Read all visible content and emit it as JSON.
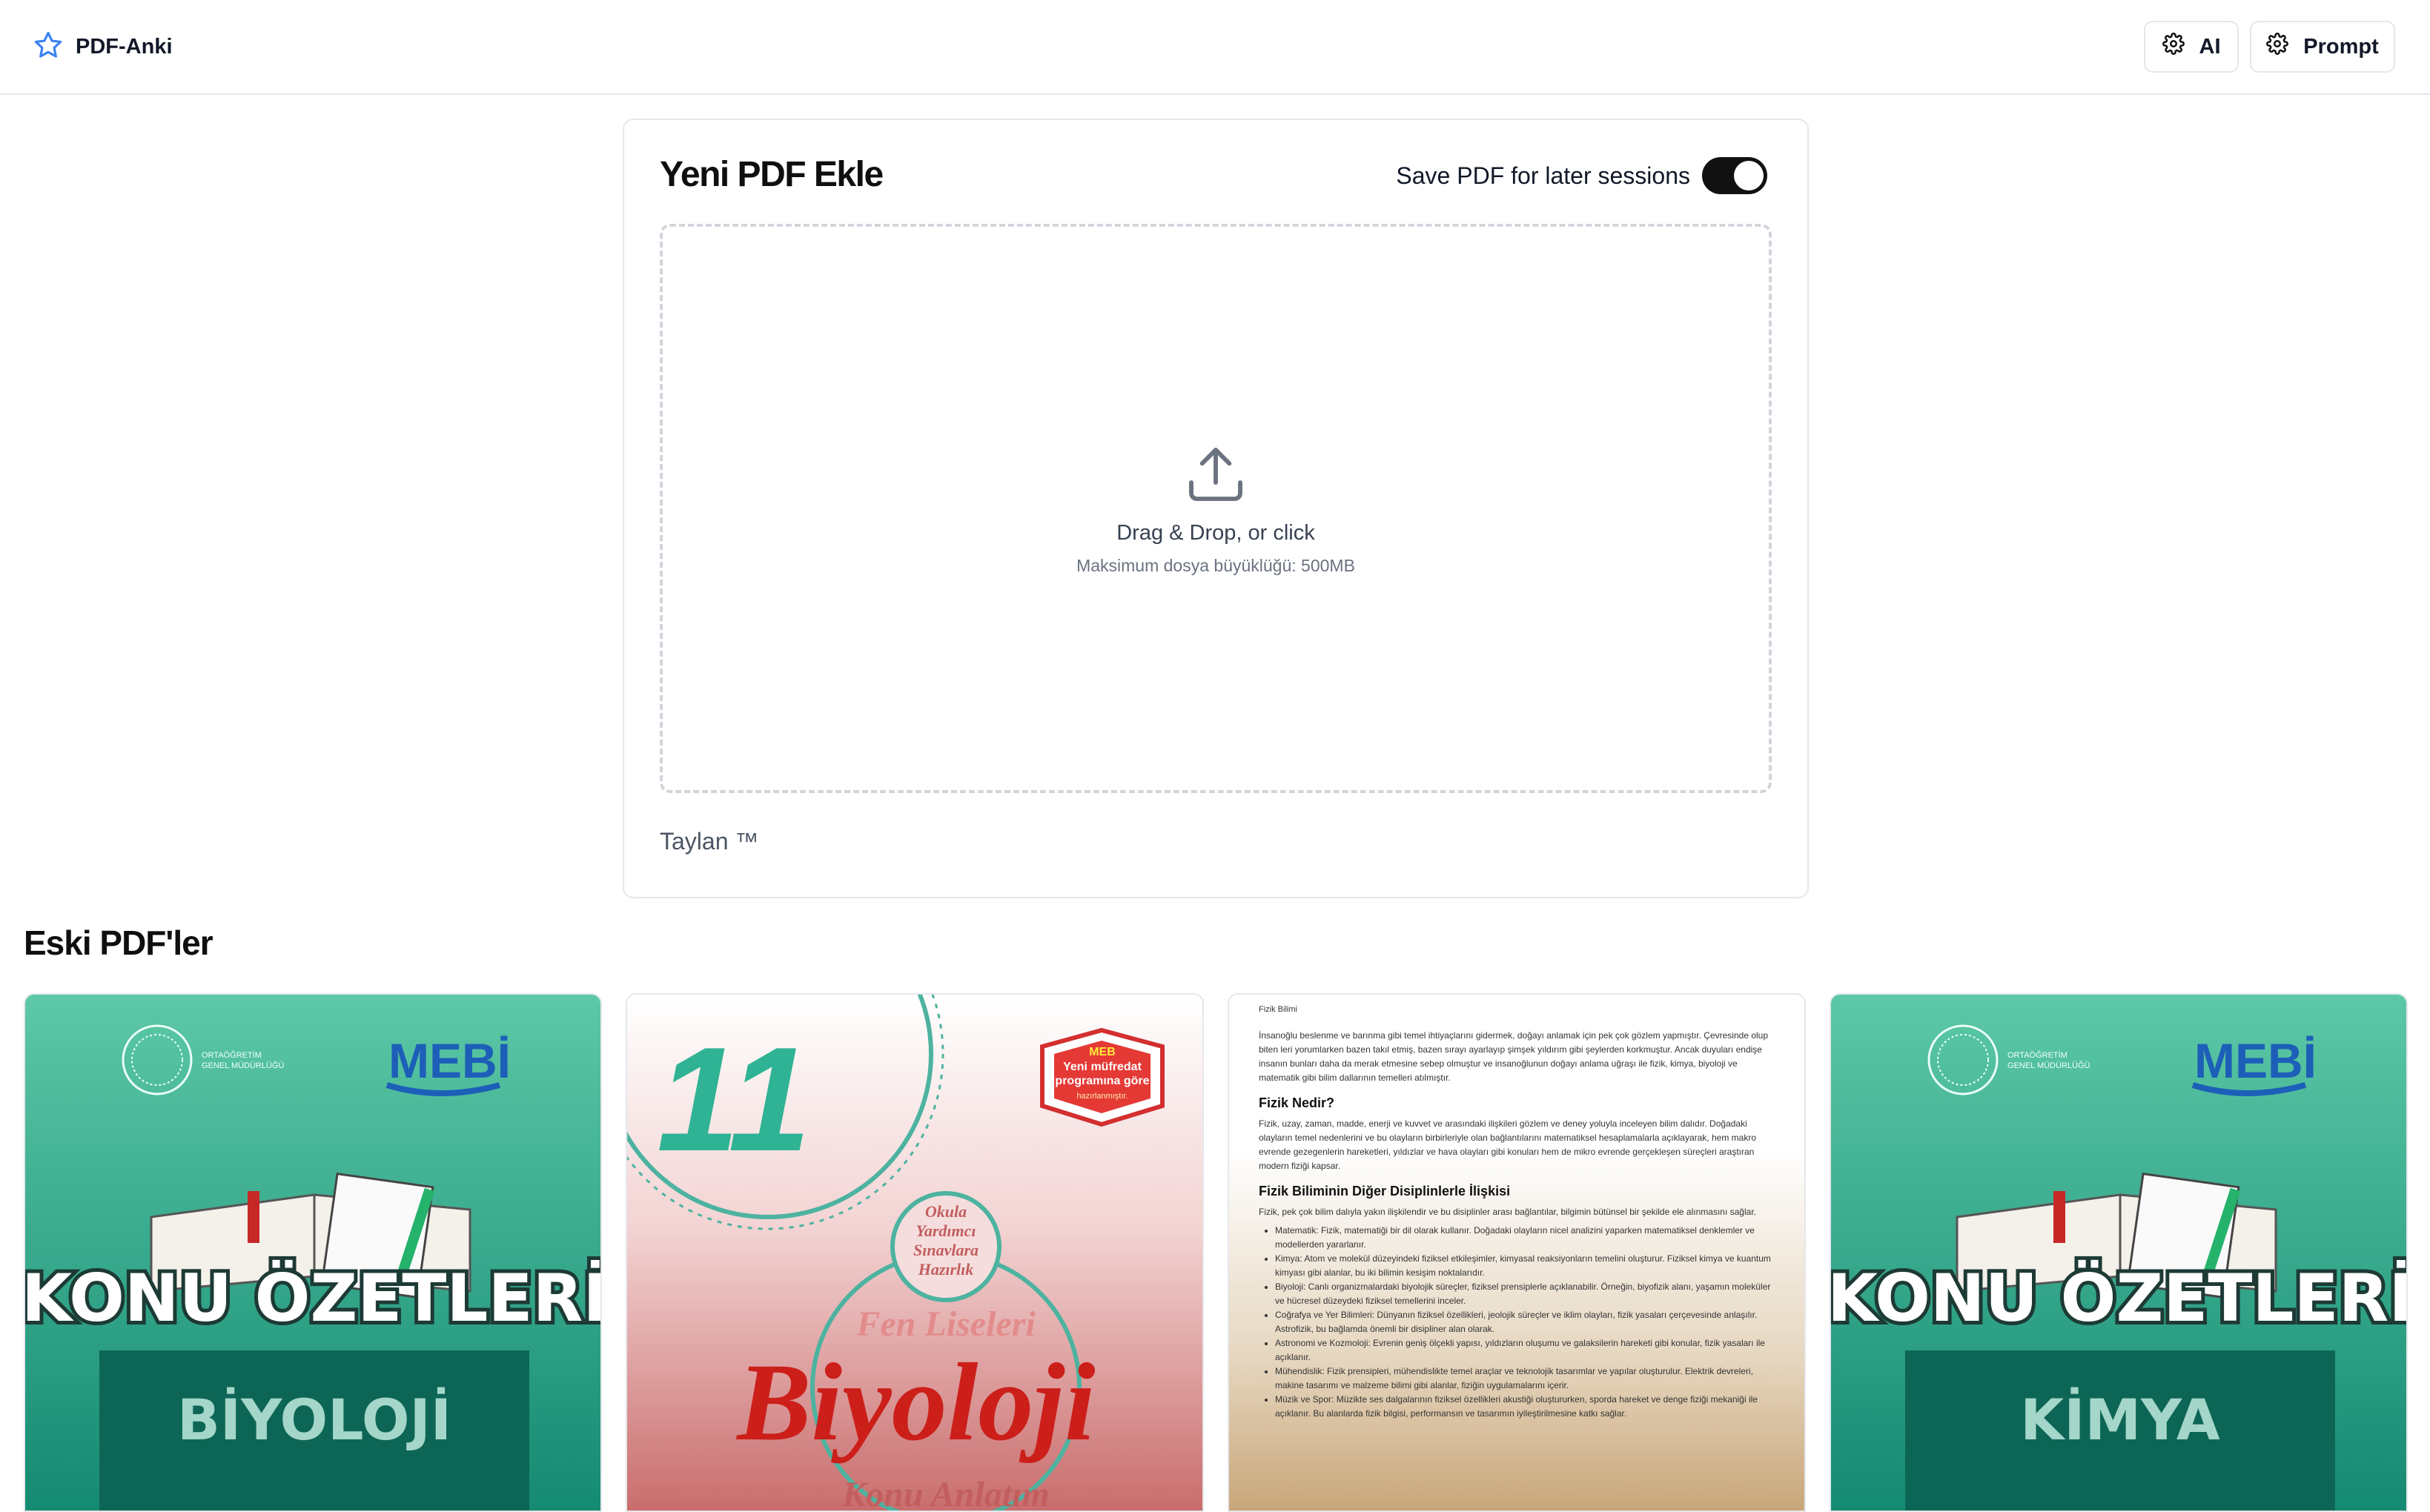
{
  "app": {
    "title": "PDF-Anki"
  },
  "header": {
    "ai_label": "AI",
    "prompt_label": "Prompt"
  },
  "upload": {
    "title": "Yeni PDF Ekle",
    "save_toggle_label": "Save PDF for later sessions",
    "save_toggle_on": true,
    "drop_title": "Drag & Drop, or click",
    "drop_subtitle": "Maksimum dosya büyüklüğü: 500MB",
    "footer": "Taylan ™"
  },
  "old_pdfs": {
    "title": "Eski PDF'ler",
    "items": [
      {
        "brand": "MEBİ",
        "org_line1": "ORTAÖĞRETİM",
        "org_line2": "GENEL MÜDÜRLÜĞÜ",
        "title": "KONU ÖZETLERİ",
        "subject": "BİYOLOJİ"
      },
      {
        "grade": "11",
        "badge_line1": "MEB",
        "badge_line2": "Yeni müfredat",
        "badge_line3": "programına göre",
        "badge_line4": "hazırlanmıştır.",
        "circle_line1": "Okula",
        "circle_line2": "Yardımcı",
        "circle_line3": "Sınavlara",
        "circle_line4": "Hazırlık",
        "series": "Fen Liseleri",
        "title": "Biyoloji",
        "subtitle": "Konu Anlatım"
      },
      {
        "running_head": "Fizik Bilimi",
        "intro": "İnsanoğlu beslenme ve barınma gibi temel ihtiyaçlarını gidermek, doğayı anlamak için pek çok gözlem yapmıştır. Çevresinde olup biten leri yorumlarken bazen takıl etmiş, bazen sırayı ayarlayıp şimşek yıldırım gibi şeylerden korkmuştur. Ancak duyuları endişe insanın bunları daha da merak etmesine sebep olmuştur ve insanoğlunun doğayı anlama uğraşı ile fizik, kimya, biyoloji ve matematik gibi bilim dallarının temelleri atılmıştır.",
        "h1": "Fizik Nedir?",
        "p1": "Fizik, uzay, zaman, madde, enerji ve kuvvet ve arasındaki ilişkileri gözlem ve deney yoluyla inceleyen bilim dalıdır. Doğadaki olayların temel nedenlerini ve bu olayların birbirleriyle olan bağlantılarını matematiksel hesaplamalarla açıklayarak, hem makro evrende gezegenlerin hareketleri, yıldızlar ve hava olayları gibi konuları hem de mikro evrende gerçekleşen süreçleri araştıran modern fiziği kapsar.",
        "h2": "Fizik Biliminin Diğer Disiplinlerle İlişkisi",
        "p2": "Fizik, pek çok bilim dalıyla yakın ilişkilendir ve bu disiplinler arası bağlantılar, bilgimin bütünsel bir şekilde ele alınmasını sağlar.",
        "bullets": [
          "Matematik: Fizik, matematiği bir dil olarak kullanır. Doğadaki olayların nicel analizini yaparken matematiksel denklemler ve modellerden yararlanır.",
          "Kimya: Atom ve molekül düzeyindeki fiziksel etkileşimler, kimyasal reaksiyonların temelini oluşturur. Fiziksel kimya ve kuantum kimyası gibi alanlar, bu iki bilimin kesişim noktalarıdır.",
          "Biyoloji: Canlı organizmalardaki biyolojik süreçler, fiziksel prensiplerle açıklanabilir. Örneğin, biyofizik alanı, yaşamın moleküler ve hücresel düzeydeki fiziksel temellerini inceler.",
          "Coğrafya ve Yer Bilimleri: Dünyanın fiziksel özellikleri, jeolojik süreçler ve iklim olayları, fizik yasaları çerçevesinde anlaşılır. Astrofizik, bu bağlamda önemli bir disipliner alan olarak.",
          "Astronomi ve Kozmoloji: Evrenin geniş ölçekli yapısı, yıldızların oluşumu ve galaksilerin hareketi gibi konular, fizik yasaları ile açıklanır.",
          "Mühendislik: Fizik prensipleri, mühendislikte temel araçlar ve teknolojik tasarımlar ve yapılar oluşturulur. Elektrik devreleri, makine tasarımı ve malzeme bilimi gibi alanlar, fiziğin uygulamalarını içerir.",
          "Müzik ve Spor: Müzikte ses dalgalarının fiziksel özellikleri akustiği oluştururken, sporda hareket ve denge fiziği mekaniği ile açıklanır. Bu alanlarda fizik bilgisi, performansın ve tasarımın iyileştirilmesine katkı sağlar."
        ]
      },
      {
        "brand": "MEBİ",
        "org_line1": "ORTAÖĞRETİM",
        "org_line2": "GENEL MÜDÜRLÜĞÜ",
        "title": "KONU ÖZETLERİ",
        "subject": "KİMYA"
      }
    ]
  },
  "colors": {
    "accent_star": "#3b82f6",
    "toggle_on": "#111111",
    "teal": "#2fb394",
    "biyoloji_red": "#cc1f1a"
  }
}
